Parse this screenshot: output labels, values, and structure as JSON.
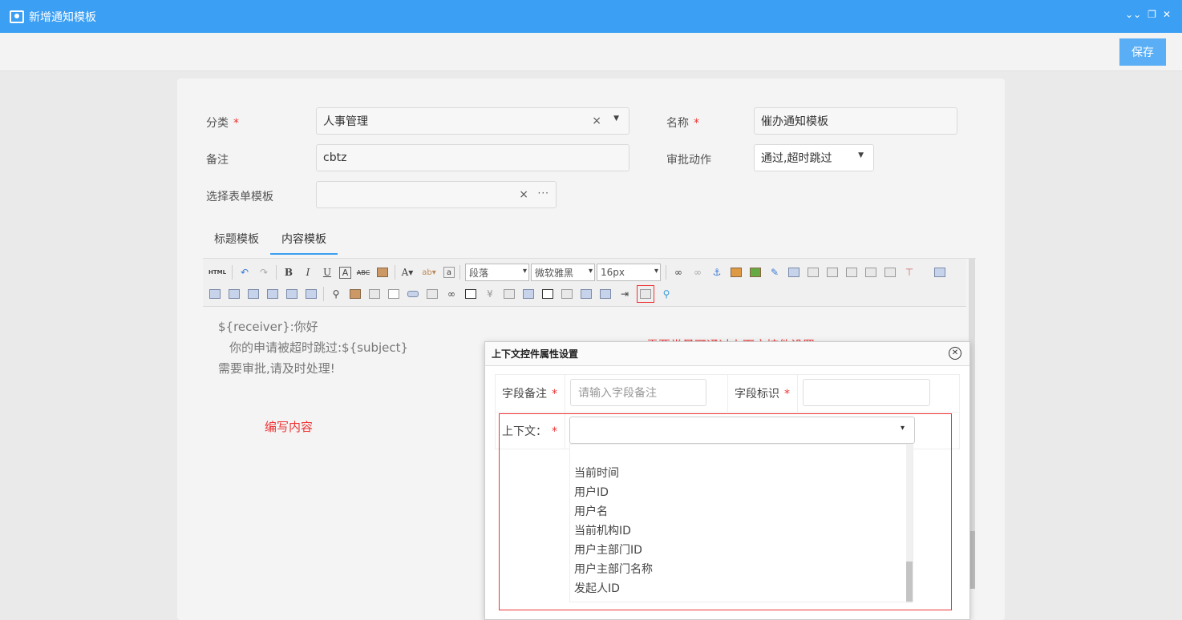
{
  "window": {
    "title": "新增通知模板",
    "controls": [
      "⌄⌄",
      "❐",
      "✕"
    ]
  },
  "toolbar": {
    "save_label": "保存"
  },
  "form": {
    "category_label": "分类",
    "category_value": "人事管理",
    "name_label": "名称",
    "name_value": "催办通知模板",
    "remark_label": "备注",
    "remark_value": "cbtz",
    "action_label": "审批动作",
    "action_value": "通过,超时跳过",
    "template_label": "选择表单模板",
    "template_value": "",
    "required_mark": "*",
    "clear_glyph": "×",
    "more_glyph": "···"
  },
  "tabs": [
    {
      "label": "标题模板",
      "active": false
    },
    {
      "label": "内容模板",
      "active": true
    }
  ],
  "editor": {
    "html_label": "HTML",
    "paragraph_select": "段落",
    "font_select": "微软雅黑",
    "size_select": "16px",
    "content_lines": [
      "${receiver}:你好",
      "你的申请被超时跳过:${subject}",
      "需要审批,请及时处理!"
    ]
  },
  "annotations": {
    "write_content": "编写内容",
    "constant_note": "需要常量可通过上下文控件设置"
  },
  "dialog": {
    "title": "上下文控件属性设置",
    "field_remark_label": "字段备注",
    "field_remark_placeholder": "请输入字段备注",
    "field_id_label": "字段标识",
    "context_label": "上下文：",
    "options": [
      "当前时间",
      "用户ID",
      "用户名",
      "当前机构ID",
      "用户主部门ID",
      "用户主部门名称",
      "发起人ID"
    ]
  },
  "colors": {
    "title_bar": "#3b9ff3",
    "save_button": "#5aaef5",
    "required": "#e33333",
    "annotation": "#e33333"
  }
}
